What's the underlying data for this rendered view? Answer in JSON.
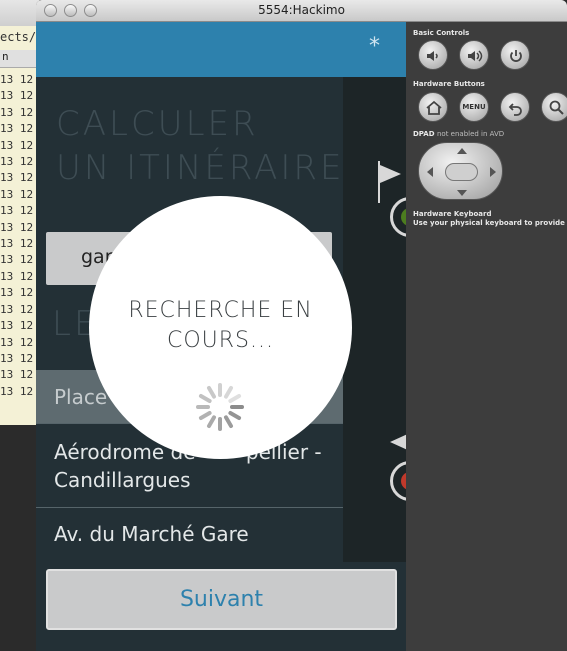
{
  "background_window": {
    "path_fragment": "ects/L",
    "column_header": "n",
    "row_prefix": "13 12"
  },
  "window": {
    "title": "5554:Hackimo"
  },
  "screen": {
    "action_bar": {
      "star_icon": "*",
      "color": "#2d81ad"
    },
    "heading_line1": "CALCULER",
    "heading_line2": "UN ITINÉRAIRE",
    "origin_input_value": "gar",
    "section_label": "LES",
    "section_sub": "."
  },
  "results": [
    {
      "text": "Place",
      "selected": true
    },
    {
      "text": "Aérodrome de Montpellier - Candillargues",
      "visible_line1": "Aérodrome de",
      "visible_tail": "pellier -",
      "visible_line2": "Candillargues",
      "selected": false
    },
    {
      "text": "Av. du Marché Gare",
      "selected": false
    }
  ],
  "next_button": {
    "label": "Suivant"
  },
  "loading": {
    "line1": "RECHERCHE EN",
    "line2": "COURS..."
  },
  "flags": {
    "start_color": "#4c7d1f",
    "end_color": "#c0392b"
  },
  "controls": {
    "basic_controls_label": "Basic Controls",
    "hardware_buttons_label": "Hardware Buttons",
    "menu_label": "MENU",
    "dpad_label": "DPAD",
    "dpad_note": "not enabled in AVD",
    "keyboard_label": "Hardware Keyboard",
    "keyboard_note": "Use your physical keyboard to provide input"
  }
}
